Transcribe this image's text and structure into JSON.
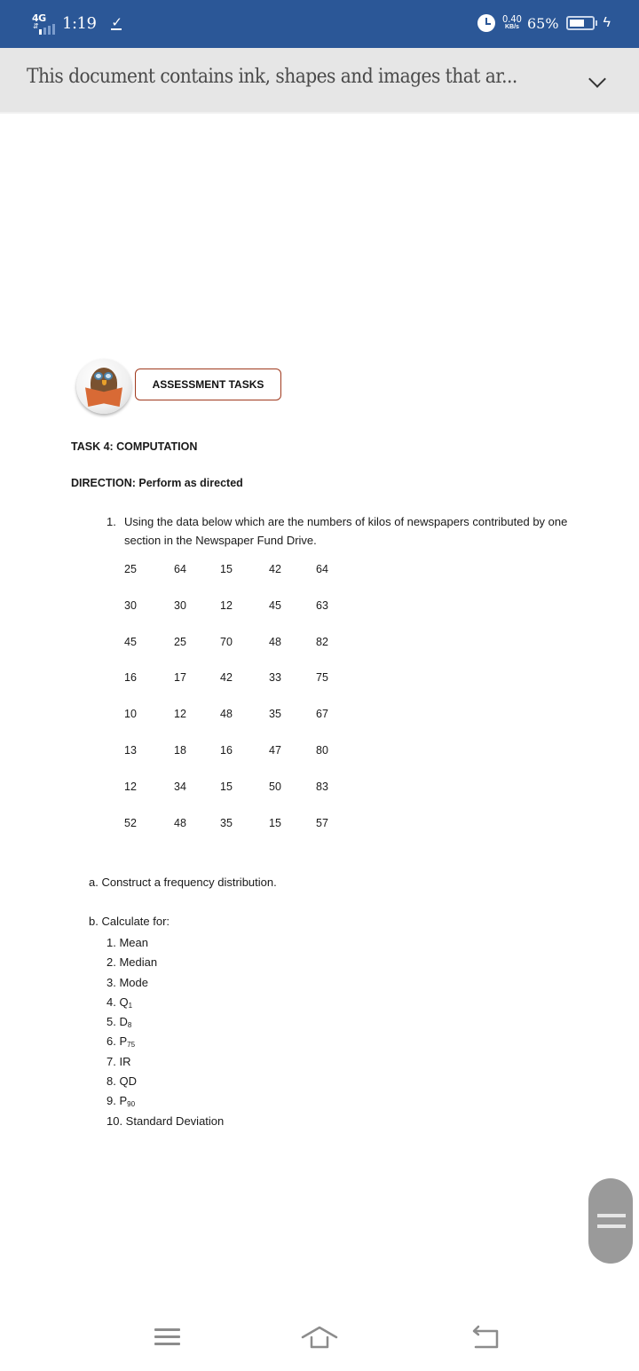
{
  "status_bar": {
    "network": "4G",
    "time": "1:19",
    "data_speed_value": "0.40",
    "data_speed_unit": "KB/s",
    "battery_percent": "65%",
    "battery_level": 0.65,
    "icons": [
      "network-4g-icon",
      "signal-icon",
      "download-check-icon",
      "alarm-icon",
      "battery-icon",
      "charging-bolt-icon"
    ]
  },
  "notice": {
    "text": "This document contains ink, shapes and images that ar...",
    "expand_icon": "chevron-down-icon"
  },
  "document": {
    "badge_image": "owl-reading-book",
    "assessment_label": "ASSESSMENT TASKS",
    "task_title": "TASK 4: COMPUTATION",
    "direction": "DIRECTION: Perform as directed",
    "question_number": "1.",
    "question_text": "Using the data below which are the numbers of kilos of newspapers contributed by one section in the Newspaper Fund Drive.",
    "data_rows": [
      [
        "25",
        "64",
        "15",
        "42",
        "64"
      ],
      [
        "30",
        "30",
        "12",
        "45",
        "63"
      ],
      [
        "45",
        "25",
        "70",
        "48",
        "82"
      ],
      [
        "16",
        "17",
        "42",
        "33",
        "75"
      ],
      [
        "10",
        "12",
        "48",
        "35",
        "67"
      ],
      [
        "13",
        "18",
        "16",
        "47",
        "80"
      ],
      [
        "12",
        "34",
        "15",
        "50",
        "83"
      ],
      [
        "52",
        "48",
        "35",
        "15",
        "57"
      ]
    ],
    "part_a": "a. Construct a frequency distribution.",
    "part_b": "b. Calculate for:",
    "calc_items": [
      {
        "label": "1. Mean",
        "sub": ""
      },
      {
        "label": "2. Median",
        "sub": ""
      },
      {
        "label": "3. Mode",
        "sub": ""
      },
      {
        "label": "4. Q",
        "sub": "1"
      },
      {
        "label": "5. D",
        "sub": "8"
      },
      {
        "label": "6. P",
        "sub": "75"
      },
      {
        "label": "7. IR",
        "sub": ""
      },
      {
        "label": "8. QD",
        "sub": ""
      },
      {
        "label": "9. P",
        "sub": "90"
      },
      {
        "label": "10. Standard Deviation",
        "sub": ""
      }
    ]
  },
  "navigation": {
    "buttons": [
      "menu",
      "home",
      "back"
    ]
  },
  "colors": {
    "status_bar_bg": "#2b5797",
    "notice_bg": "#e6e6e6",
    "assessment_border": "#a03a1e",
    "scroll_handle": "#9a9a9a"
  }
}
